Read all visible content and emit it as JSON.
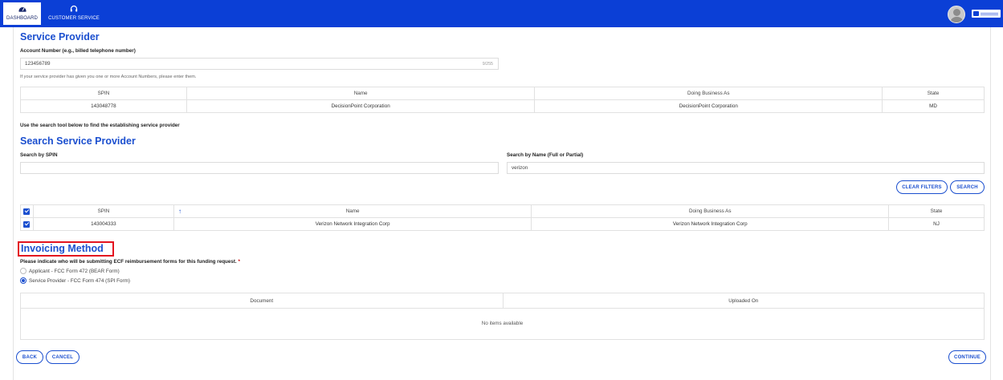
{
  "nav": {
    "tabs": [
      {
        "label": "DASHBOARD",
        "icon": "dashboard-icon"
      },
      {
        "label": "CUSTOMER SERVICE",
        "icon": "headset-icon"
      }
    ],
    "brand_color": "#0b3fd6"
  },
  "service_provider": {
    "title": "Service Provider",
    "account_label": "Account Number (e.g., billed telephone number)",
    "account_value": "123456789",
    "account_counter": "9/255",
    "account_hint": "If your service provider has given you one or more Account Numbers, please enter them.",
    "table": {
      "headers": [
        "SPIN",
        "Name",
        "Doing Business As",
        "State"
      ],
      "rows": [
        [
          "143048778",
          "DecisionPoint Corporation",
          "DecisionPoint Corporation",
          "MD"
        ]
      ]
    },
    "search_hint": "Use the search tool below to find the establishing service provider"
  },
  "search": {
    "title": "Search Service Provider",
    "spin_label": "Search by SPIN",
    "spin_value": "",
    "name_label": "Search by Name (Full or Partial)",
    "name_value": "verizon",
    "clear_label": "CLEAR FILTERS",
    "search_label": "SEARCH",
    "results": {
      "headers": [
        "SPIN",
        "Name",
        "Doing Business As",
        "State"
      ],
      "rows": [
        [
          "143004333",
          "Verizon Network Integration Corp",
          "Verizon Network Integration Corp",
          "NJ"
        ]
      ]
    }
  },
  "invoicing": {
    "title": "Invoicing Method",
    "question": "Please indicate who will be submitting ECF reimbursement forms for this funding request.",
    "required_mark": "*",
    "options": [
      {
        "label": "Applicant - FCC Form 472 (BEAR Form)",
        "selected": false
      },
      {
        "label": "Service Provider - FCC Form 474 (SPI Form)",
        "selected": true
      }
    ],
    "docs": {
      "headers": [
        "Document",
        "Uploaded On"
      ],
      "empty_text": "No items available"
    }
  },
  "footer": {
    "back_label": "BACK",
    "cancel_label": "CANCEL",
    "continue_label": "CONTINUE"
  }
}
